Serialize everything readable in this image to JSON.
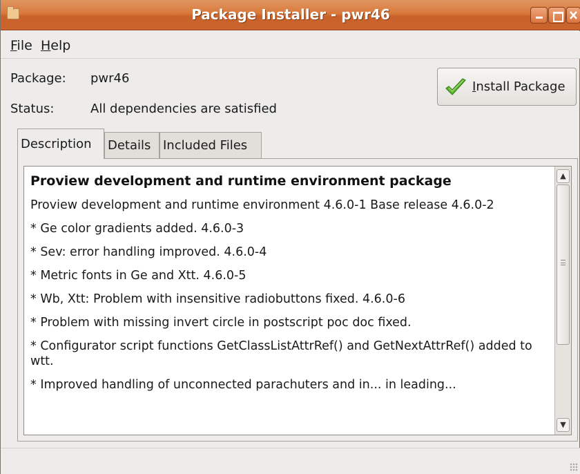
{
  "window": {
    "title": "Package Installer - pwr46",
    "controls": [
      "minimize",
      "maximize",
      "close"
    ]
  },
  "menu": {
    "file": {
      "accel": "F",
      "rest": "ile"
    },
    "help": {
      "accel": "H",
      "rest": "elp"
    }
  },
  "info": {
    "package_label": "Package:",
    "package_value": "pwr46",
    "status_label": "Status:",
    "status_value": "All dependencies are satisfied"
  },
  "install_button": {
    "accel": "I",
    "rest": "nstall Package",
    "icon": "green-check-icon"
  },
  "tabs": [
    {
      "label": "Description",
      "active": true
    },
    {
      "label": "Details",
      "active": false
    },
    {
      "label": "Included Files",
      "active": false
    }
  ],
  "description": {
    "heading": "Proview development and runtime environment package",
    "paragraphs": [
      "Proview development and runtime environment 4.6.0-1 Base release 4.6.0-2",
      "* Ge color gradients added. 4.6.0-3",
      "* Sev: error handling improved. 4.6.0-4",
      "* Metric fonts in Ge and Xtt. 4.6.0-5",
      "* Wb, Xtt: Problem with insensitive radiobuttons fixed. 4.6.0-6",
      "* Problem with missing invert circle in postscript poc doc fixed.",
      "* Configurator script functions GetClassListAttrRef() and GetNextAttrRef() added to wtt.",
      "* Improved handling of unconnected parachuters and in... in leading..."
    ]
  },
  "colors": {
    "titlebar": "#d97a3c",
    "window_bg": "#edeceb",
    "check_green": "#4aa02c"
  }
}
